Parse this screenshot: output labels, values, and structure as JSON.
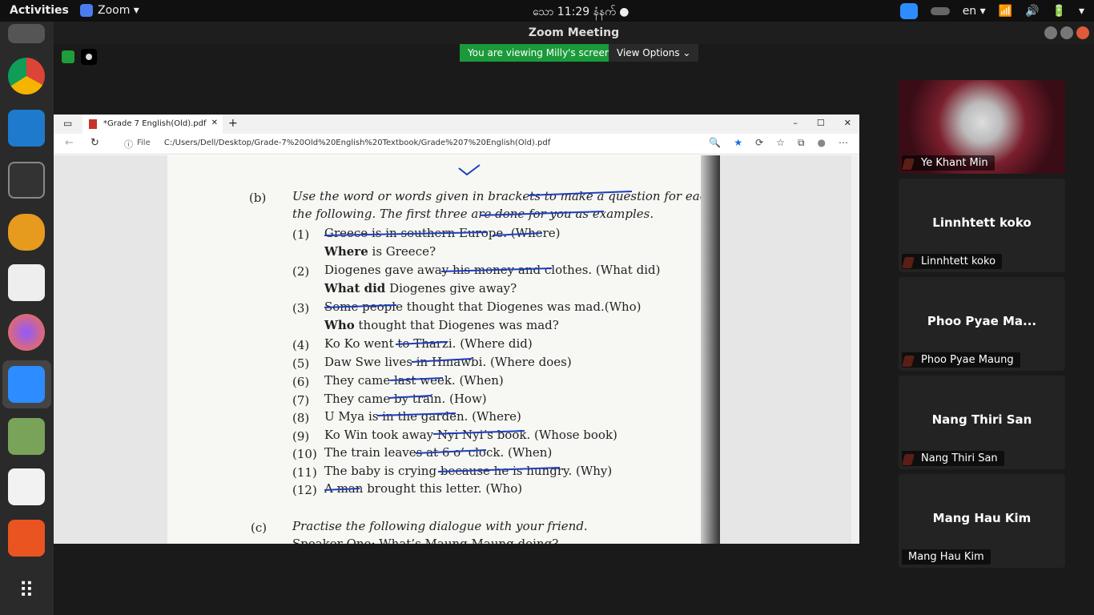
{
  "topbar": {
    "activities": "Activities",
    "app": "Zoom ▾",
    "clock": "သော  11:29 နံနက် ●",
    "lang": "en ▾"
  },
  "dock": {
    "items": [
      "files-icon",
      "chrome-icon",
      "vscode-icon",
      "terminal-icon",
      "pgadmin-icon",
      "text-editor-icon",
      "firefox-icon",
      "zoom-icon",
      "image-viewer-icon",
      "document-viewer-icon",
      "software-icon",
      "apps-grid-icon"
    ]
  },
  "window": {
    "title": "Zoom Meeting"
  },
  "meeting": {
    "viewing": "You are viewing Milly's screen",
    "view_options": "View Options ⌄"
  },
  "browser": {
    "tab_title": "*Grade 7 English(Old).pdf",
    "tab_close": "✕",
    "new_tab": "+",
    "window_ctrls": [
      "–",
      "☐",
      "✕"
    ],
    "file_label": "File",
    "url": "C:/Users/Dell/Desktop/Grade-7%20Old%20English%20Textbook/Grade%207%20English(Old).pdf",
    "nav": [
      "←",
      "↻",
      "ⓘ"
    ],
    "toolbar_icons": [
      "🔍",
      "★",
      "⟳",
      "☆",
      "⧉",
      "●",
      "⋯"
    ]
  },
  "pdf": {
    "section_b": "(b)",
    "instruction1": "Use the word or words given in brackets to make a question for each of",
    "instruction2": "the following. The first three are done for you as examples.",
    "items": [
      {
        "n": "(1)",
        "text": "Greece is in southern Europe. (Where)",
        "answer_bold": "Where",
        "answer_rest": " is Greece?"
      },
      {
        "n": "(2)",
        "text": "Diogenes gave away his money and clothes. (What did)",
        "answer_bold": "What did",
        "answer_rest": " Diogenes give away?"
      },
      {
        "n": "(3)",
        "text": "Some people thought that Diogenes was mad.(Who)",
        "answer_bold": "Who",
        "answer_rest": " thought that Diogenes was mad?"
      },
      {
        "n": "(4)",
        "text": "Ko Ko went to Tharzi. (Where did)"
      },
      {
        "n": "(5)",
        "text": "Daw Swe lives in Hmawbi. (Where does)"
      },
      {
        "n": "(6)",
        "text": "They came last week. (When)"
      },
      {
        "n": "(7)",
        "text": "They came by train. (How)"
      },
      {
        "n": "(8)",
        "text": "U Mya is in the garden. (Where)"
      },
      {
        "n": "(9)",
        "text": "Ko Win took away Nyi Nyi’s book. (Whose book)"
      },
      {
        "n": "(10)",
        "text": "The train leaves at 6 o’ clock. (When)"
      },
      {
        "n": "(11)",
        "text": "The baby is crying because he is hungry. (Why)"
      },
      {
        "n": "(12)",
        "text": "A man brought this letter. (Who)"
      }
    ],
    "section_c": "(c)",
    "section_c_text": "Practise the following dialogue with your friend.",
    "last_line": "Speaker One: What’s Maung Maung doing?"
  },
  "participants": [
    {
      "big": "",
      "label": "Ye Khant Min",
      "muted": true,
      "has_photo": true
    },
    {
      "big": "Linnhtett koko",
      "label": "Linnhtett koko",
      "muted": true
    },
    {
      "big": "Phoo Pyae Ma...",
      "label": "Phoo Pyae Maung",
      "muted": true
    },
    {
      "big": "Nang Thiri San",
      "label": "Nang Thiri San",
      "muted": true
    },
    {
      "big": "Mang Hau Kim",
      "label": "Mang Hau Kim",
      "muted": false
    }
  ],
  "colors": {
    "accent_green": "#1a9a3a",
    "zoom_blue": "#2d8cff",
    "mute_red": "#e24b3b",
    "ink_blue": "#1c3fbf"
  }
}
